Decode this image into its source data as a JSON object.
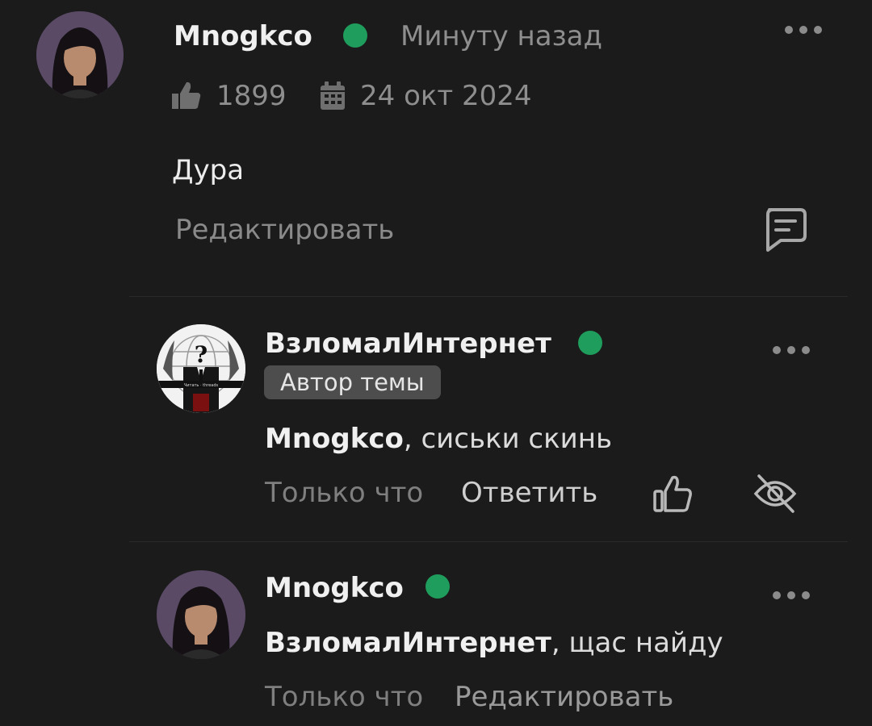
{
  "post": {
    "author": "Mnogkco",
    "time": "Минуту назад",
    "likes": "1899",
    "date": "24 окт 2024",
    "text": "Дура",
    "edit_label": "Редактировать"
  },
  "comments": [
    {
      "author": "ВзломалИнтернет",
      "badge": "Автор темы",
      "mention": "Mnogkco",
      "text": ", сиськи скинь",
      "time": "Только что",
      "reply_label": "Ответить"
    },
    {
      "author": "Mnogkco",
      "mention": "ВзломалИнтернет",
      "text": ", щас найду",
      "time": "Только что",
      "edit_label": "Редактировать"
    }
  ],
  "icons": {
    "like": "thumbs-up-icon",
    "calendar": "calendar-icon",
    "comment": "comment-icon",
    "hide": "eye-off-icon",
    "more": "more-dots-icon"
  },
  "colors": {
    "background": "#1b1b1b",
    "online": "#1f9d5c",
    "badge_bg": "#4d4d4d"
  }
}
